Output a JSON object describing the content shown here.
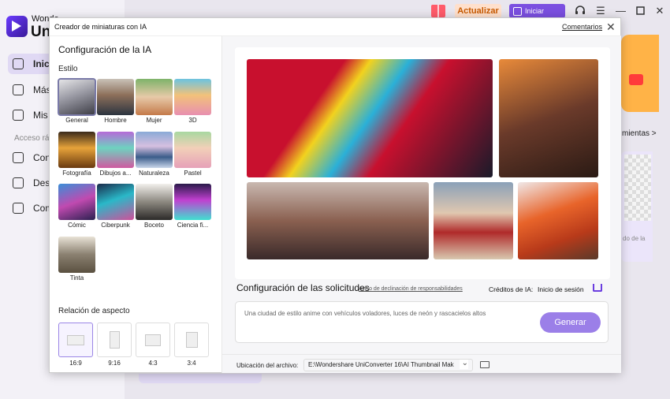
{
  "app": {
    "brand_small": "Wonde",
    "brand_large": "Uni",
    "sidebar": [
      {
        "label": "Inici",
        "active": true
      },
      {
        "label": "Más l"
      },
      {
        "label": "Mis a"
      },
      {
        "label": "Conv"
      },
      {
        "label": "Desca"
      },
      {
        "label": "Comp"
      }
    ],
    "section_label": "Acceso ráp",
    "upgrade_label": "Actualizar",
    "login_label": "Iniciar Sesión",
    "tools_link": "mientas >",
    "card_caption": "do de la"
  },
  "modal": {
    "title": "Creador de miniaturas con IA",
    "feedback": "Comentarios",
    "close": "✕",
    "ai_settings_title": "Configuración de la IA",
    "style_label": "Estilo",
    "styles": [
      {
        "label": "General",
        "selected": true
      },
      {
        "label": "Hombre"
      },
      {
        "label": "Mujer"
      },
      {
        "label": "3D"
      },
      {
        "label": "Fotografía"
      },
      {
        "label": "Dibujos a..."
      },
      {
        "label": "Naturaleza"
      },
      {
        "label": "Pastel"
      },
      {
        "label": "Cómic"
      },
      {
        "label": "Ciberpunk"
      },
      {
        "label": "Boceto"
      },
      {
        "label": "Ciencia fi..."
      },
      {
        "label": "Tinta"
      }
    ],
    "aspect_label": "Relación de aspecto",
    "ratios": [
      {
        "label": "16:9",
        "selected": true
      },
      {
        "label": "9:16"
      },
      {
        "label": "4:3"
      },
      {
        "label": "3:4"
      }
    ],
    "requests_title": "Configuración de las solicitudes",
    "disclaimer": "Aviso de declinación de responsabilidades",
    "credits_label": "Créditos de IA:",
    "credits_value": "Inicio de sesión",
    "prompt_placeholder": "Una ciudad de estilo anime con vehículos voladores, luces de neón y rascacielos altos",
    "generate_label": "Generar",
    "file_location_label": "Ubicación del archivo:",
    "file_path": "E:\\Wondershare UniConverter 16\\AI Thumbnail Mak"
  },
  "colors": {
    "accent": "#7b4fe0",
    "generate": "#9b7fe8",
    "upgrade_bg": "#ffe0cc",
    "upgrade_text": "#c85a00"
  },
  "icons": [
    "gift-icon",
    "headset-icon",
    "menu-icon",
    "minimize-icon",
    "maximize-icon",
    "close-icon",
    "cart-icon",
    "folder-icon",
    "chevron-down-icon"
  ]
}
